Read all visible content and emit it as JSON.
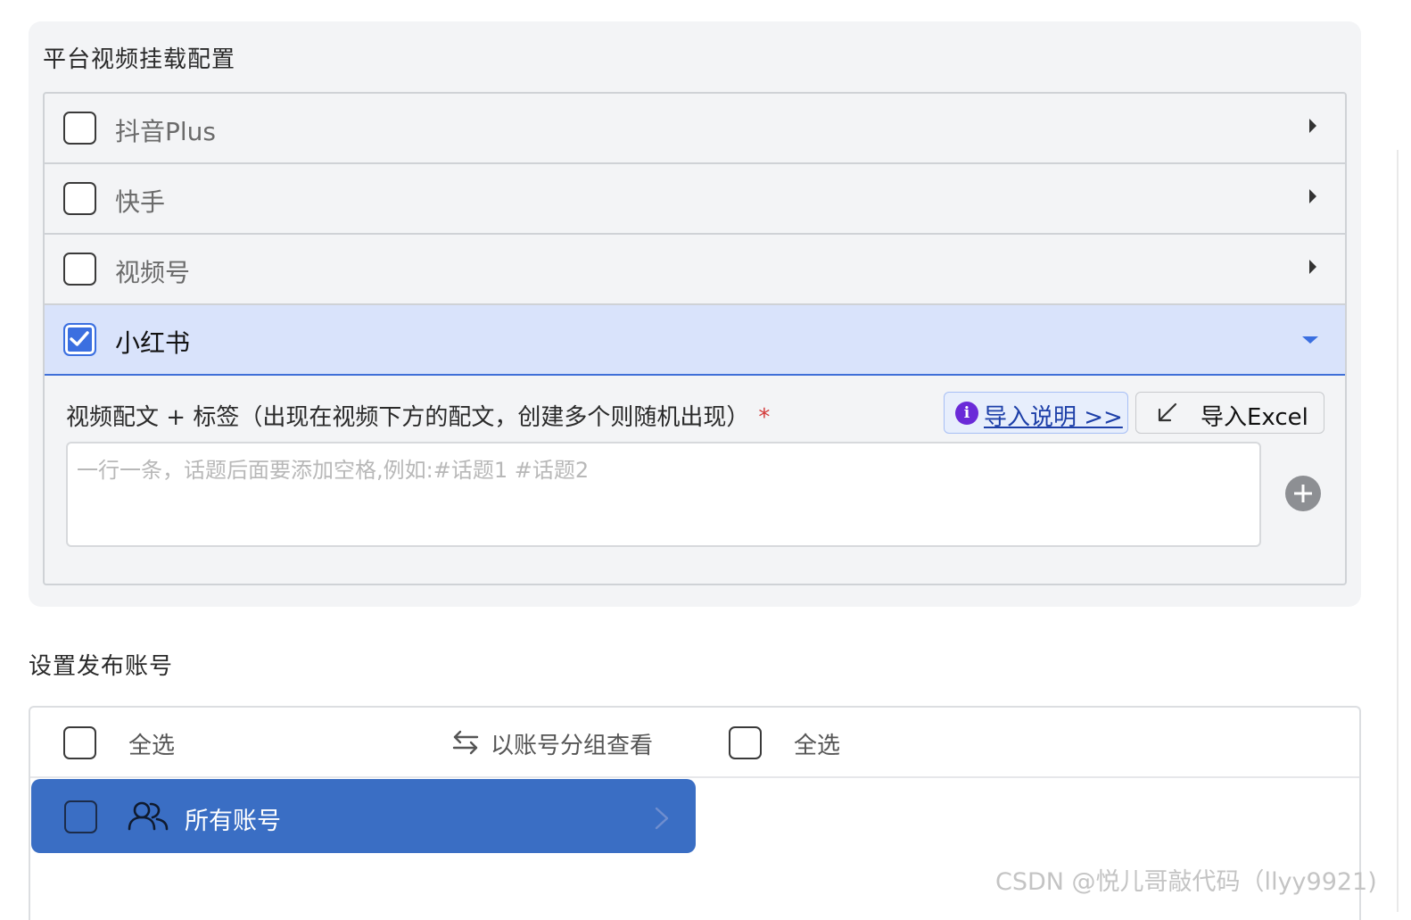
{
  "platform_config": {
    "title": "平台视频挂载配置",
    "platforms": [
      {
        "label": "抖音Plus",
        "checked": false,
        "expanded": false
      },
      {
        "label": "快手",
        "checked": false,
        "expanded": false
      },
      {
        "label": "视频号",
        "checked": false,
        "expanded": false
      },
      {
        "label": "小红书",
        "checked": true,
        "expanded": true
      }
    ],
    "caption_field": {
      "label": "视频配文 + 标签（出现在视频下方的配文，创建多个则随机出现）",
      "required_mark": "*",
      "placeholder": "一行一条，话题后面要添加空格,例如:#话题1 #话题2",
      "value": ""
    },
    "import_help_label": "导入说明 >>",
    "import_excel_label": "导入Excel"
  },
  "accounts": {
    "title": "设置发布账号",
    "select_all_label": "全选",
    "group_view_label": "以账号分组查看",
    "select_all_right_label": "全选",
    "groups": [
      {
        "label": "所有账号",
        "checked": false
      }
    ]
  },
  "watermark": "CSDN @悦儿哥敲代码（llyy9921)",
  "colors": {
    "accent": "#3b6fe0",
    "active_row_bg": "#d9e3fb",
    "group_bg": "#3a6ec4",
    "info_icon": "#6a2ad8",
    "required": "#d33b3b"
  }
}
